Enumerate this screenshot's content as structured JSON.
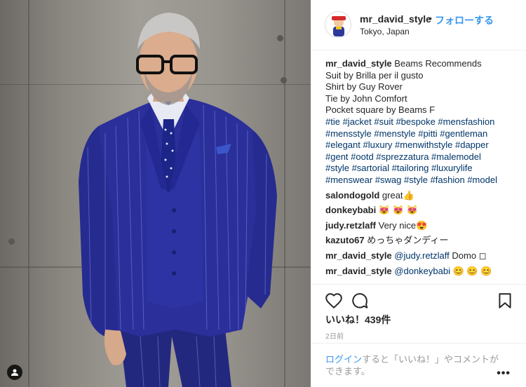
{
  "post": {
    "username": "mr_david_style",
    "separator": "•",
    "follow_label": "フォローする",
    "location": "Tokyo, Japan"
  },
  "caption": {
    "username": "mr_david_style",
    "lines": [
      "Beams Recommends",
      "Suit by Brilla per il gusto",
      "Shirt by Guy Rover",
      "Tie by John Comfort",
      "Pocket square by Beams F"
    ],
    "hashtag_lines": [
      "#tie #jacket #suit #bespoke #mensfashion",
      "#mensstyle #menstyle #pitti #gentleman",
      "#elegant #luxury #menwithstyle #dapper",
      "#gent #ootd #sprezzatura #malemodel",
      "#style #sartorial #tailoring #luxurylife",
      "#menswear #swag #style #fashion #model"
    ]
  },
  "comments": [
    {
      "user": "salondogold",
      "text": "great👍"
    },
    {
      "user": "donkeybabi",
      "text": "😻 😻 😻"
    },
    {
      "user": "judy.retzlaff",
      "text": "Very nice😍"
    },
    {
      "user": "kazuto67",
      "text": "めっちゃダンディー"
    },
    {
      "user": "mr_david_style",
      "mention": "@judy.retzlaff",
      "text": "Domo ◻"
    },
    {
      "user": "mr_david_style",
      "mention": "@donkeybabi",
      "text": "😊 😊 😊"
    }
  ],
  "likes": "いいね！439件",
  "time_ago": "2日前",
  "login": {
    "link": "ログイン",
    "text": "すると「いいね！」やコメントができます。"
  },
  "more_label": "•••",
  "icons": {
    "like": "heart-icon",
    "comment": "comment-icon",
    "save": "bookmark-icon",
    "user_tag": "user-tag-icon"
  },
  "colors": {
    "link": "#3897f0",
    "hashtag": "#003569",
    "suit": "#2a2f9a"
  }
}
